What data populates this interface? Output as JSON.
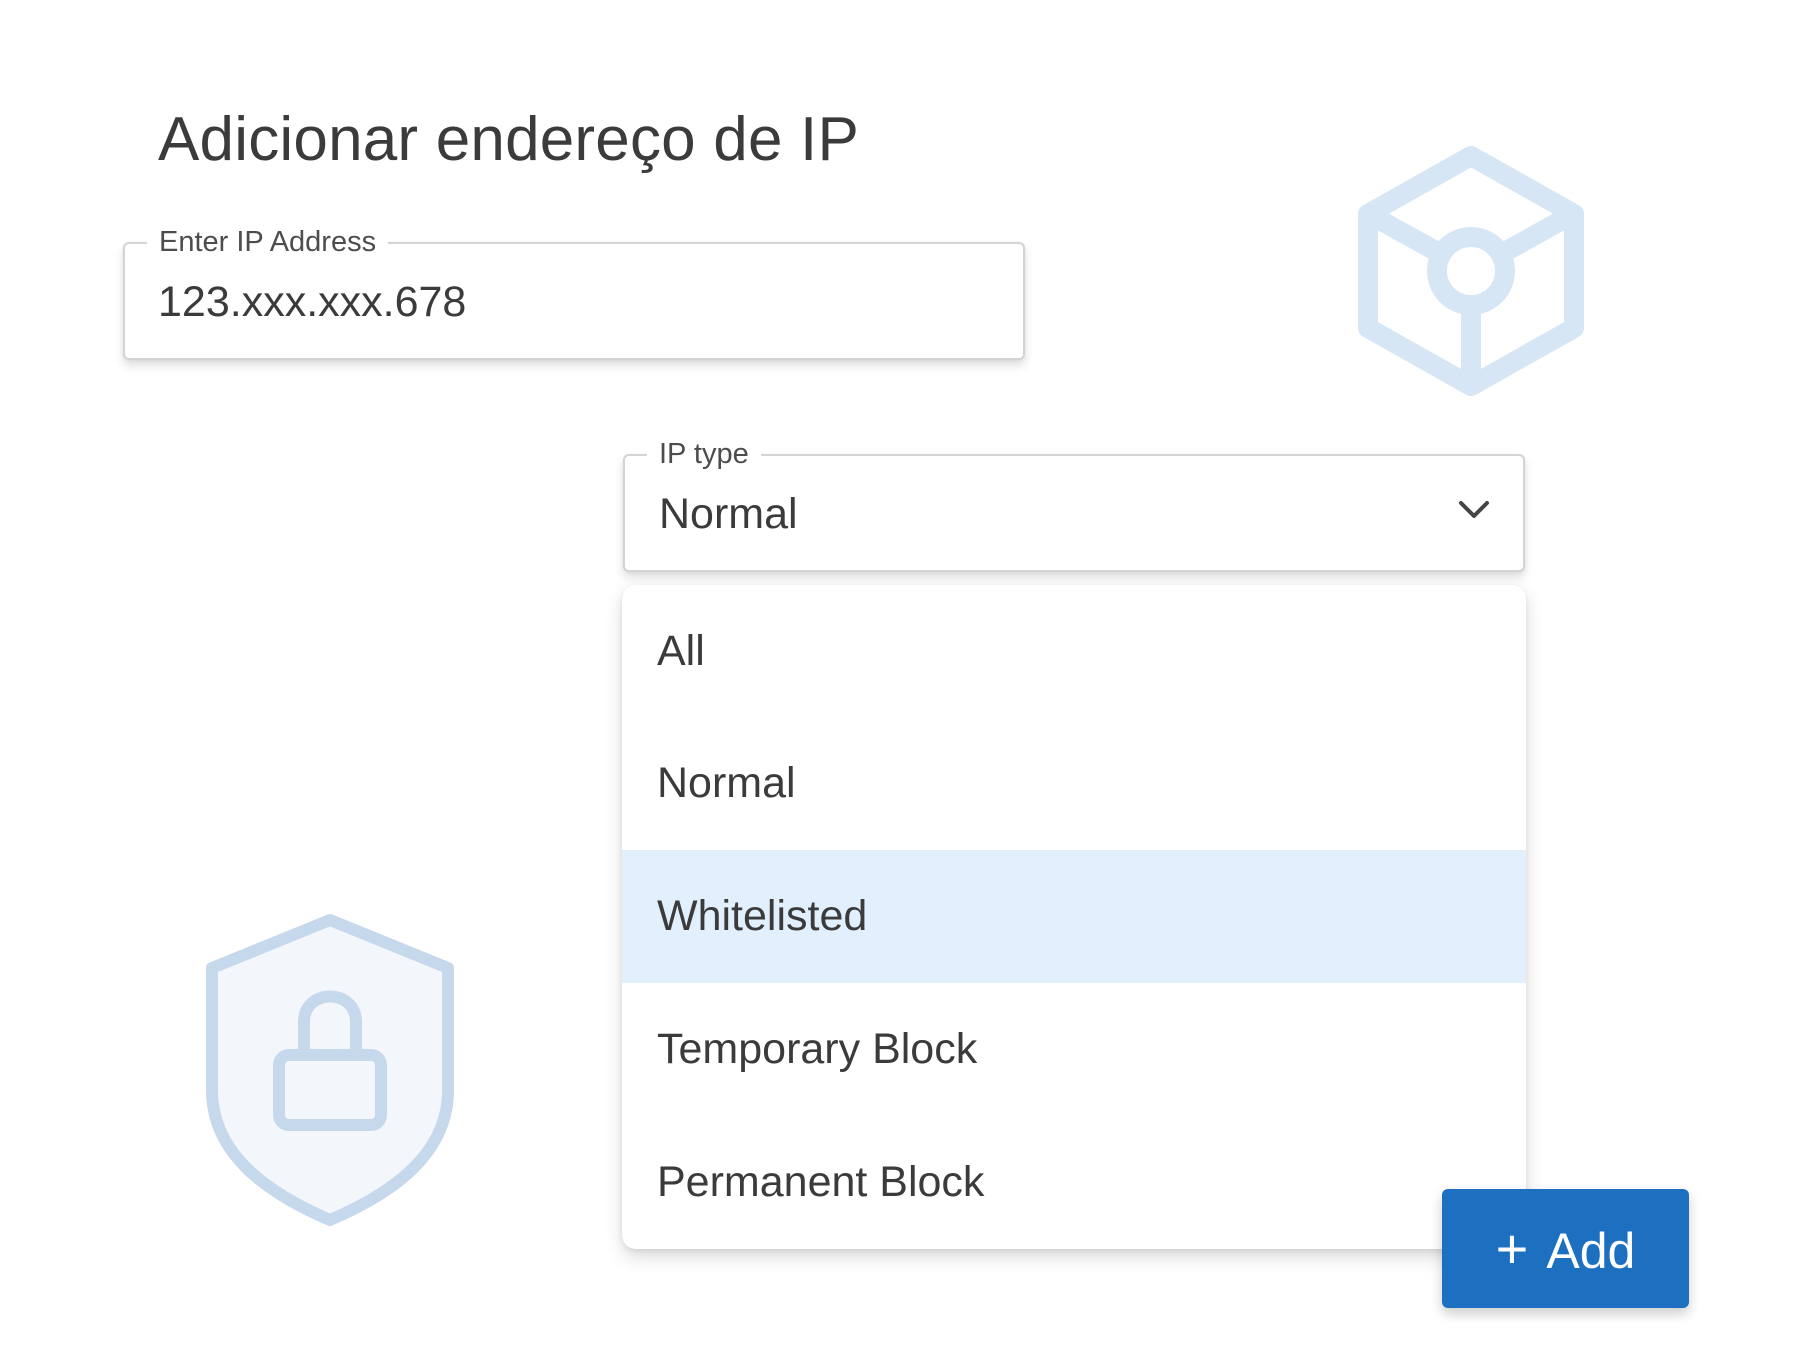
{
  "page": {
    "title": "Adicionar endereço de IP"
  },
  "ip_field": {
    "label": "Enter IP Address",
    "value": "123.xxx.xxx.678"
  },
  "ip_type": {
    "label": "IP type",
    "selected_value": "Normal",
    "options": [
      {
        "label": "All",
        "highlighted": false
      },
      {
        "label": "Normal",
        "highlighted": false
      },
      {
        "label": "Whitelisted",
        "highlighted": true
      },
      {
        "label": "Temporary Block",
        "highlighted": false
      },
      {
        "label": "Permanent Block",
        "highlighted": false
      }
    ]
  },
  "add_button": {
    "icon": "plus-icon",
    "label": "Add"
  },
  "icons": {
    "dropdown": "chevron-down-icon",
    "decor_top_right": "hexagon-cube-icon",
    "decor_bottom_left": "shield-lock-icon"
  },
  "colors": {
    "primary": "#1d70c0",
    "highlight": "#e2effd",
    "decor": "#d7e6f4",
    "text": "#3b3b3b"
  }
}
